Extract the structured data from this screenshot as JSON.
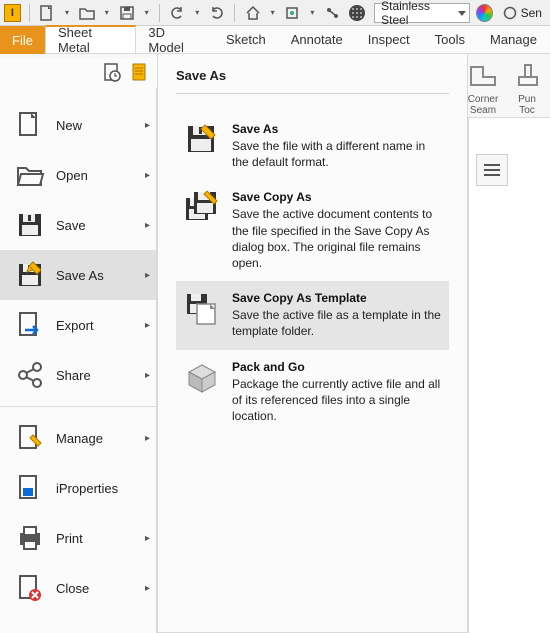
{
  "app_icon_letter": "I",
  "material": "Stainless Steel",
  "trailing_text": "Sen",
  "ribbon_tabs": {
    "file": "File",
    "items": [
      "Sheet Metal",
      "3D Model",
      "Sketch",
      "Annotate",
      "Inspect",
      "Tools",
      "Manage"
    ],
    "active_index": 0
  },
  "ribbon_groups": [
    {
      "label_line1": "Corner",
      "label_line2": "Seam"
    },
    {
      "label_line1": "Pun",
      "label_line2": "Toc"
    }
  ],
  "file_menu": [
    {
      "label": "New",
      "has_sub": true
    },
    {
      "label": "Open",
      "has_sub": true
    },
    {
      "label": "Save",
      "has_sub": true
    },
    {
      "label": "Save As",
      "has_sub": true,
      "selected": true
    },
    {
      "label": "Export",
      "has_sub": true
    },
    {
      "label": "Share",
      "has_sub": true
    },
    {
      "divider": true
    },
    {
      "label": "Manage",
      "has_sub": true
    },
    {
      "label": "iProperties",
      "has_sub": false
    },
    {
      "label": "Print",
      "has_sub": true
    },
    {
      "label": "Close",
      "has_sub": true
    }
  ],
  "submenu": {
    "title": "Save As",
    "items": [
      {
        "label": "Save As",
        "desc": "Save the file with a different name in the default format."
      },
      {
        "label": "Save Copy As",
        "desc": "Save the active document contents to the file specified in the Save Copy As dialog box. The original file remains open."
      },
      {
        "label": "Save Copy As Template",
        "desc": "Save the active file as a template in the template folder.",
        "hover": true
      },
      {
        "label": "Pack and Go",
        "desc": "Package the currently active file and all of its referenced files into a single location."
      }
    ]
  }
}
